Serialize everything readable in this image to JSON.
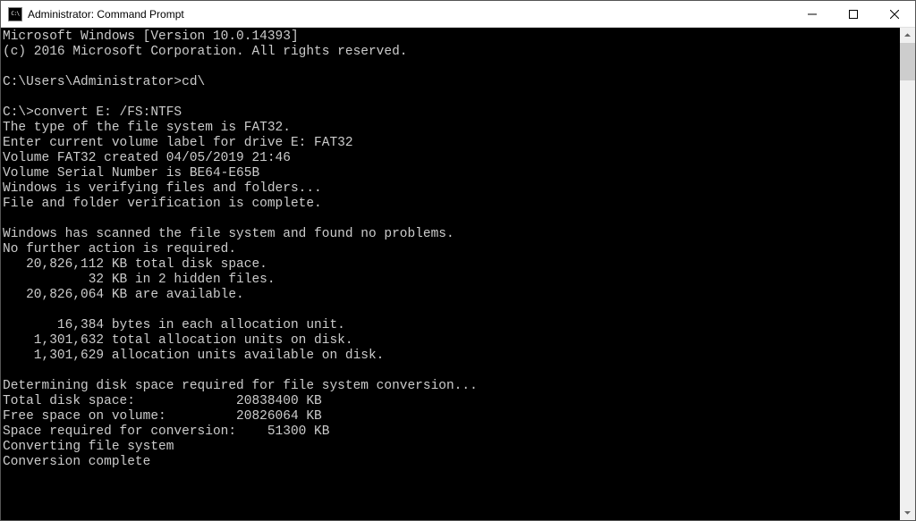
{
  "titlebar": {
    "icon_text": "C:\\",
    "title": "Administrator: Command Prompt"
  },
  "terminal": {
    "lines": [
      "Microsoft Windows [Version 10.0.14393]",
      "(c) 2016 Microsoft Corporation. All rights reserved.",
      "",
      "C:\\Users\\Administrator>cd\\",
      "",
      "C:\\>convert E: /FS:NTFS",
      "The type of the file system is FAT32.",
      "Enter current volume label for drive E: FAT32",
      "Volume FAT32 created 04/05/2019 21:46",
      "Volume Serial Number is BE64-E65B",
      "Windows is verifying files and folders...",
      "File and folder verification is complete.",
      "",
      "Windows has scanned the file system and found no problems.",
      "No further action is required.",
      "   20,826,112 KB total disk space.",
      "           32 KB in 2 hidden files.",
      "   20,826,064 KB are available.",
      "",
      "       16,384 bytes in each allocation unit.",
      "    1,301,632 total allocation units on disk.",
      "    1,301,629 allocation units available on disk.",
      "",
      "Determining disk space required for file system conversion...",
      "Total disk space:             20838400 KB",
      "Free space on volume:         20826064 KB",
      "Space required for conversion:    51300 KB",
      "Converting file system",
      "Conversion complete"
    ]
  }
}
